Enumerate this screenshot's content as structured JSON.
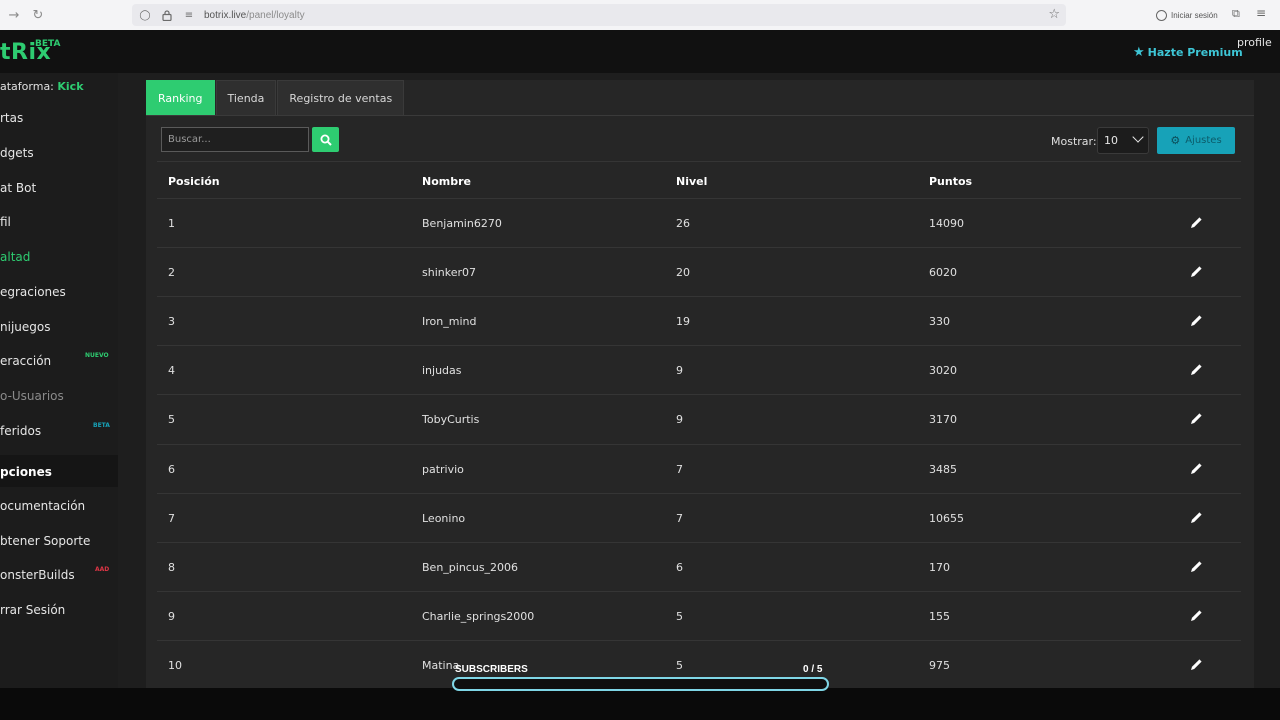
{
  "browser": {
    "url_host": "botrix.live",
    "url_path": "/panel/loyalty",
    "signin_label": "Iniciar sesión"
  },
  "header": {
    "logo": "tRix",
    "logo_badge": "BETA",
    "premium_label": "Hazte Premium",
    "profile_label": "profile"
  },
  "sidebar": {
    "platform_label": "ataforma:",
    "platform_value": "Kick",
    "items": [
      {
        "label": "rtas"
      },
      {
        "label": "dgets"
      },
      {
        "label": "at Bot"
      },
      {
        "label": "fil"
      },
      {
        "label": "altad"
      },
      {
        "label": "egraciones"
      },
      {
        "label": "nijuegos"
      },
      {
        "label": "eracción",
        "badge": "NUEVO"
      },
      {
        "label": "o-Usuarios"
      },
      {
        "label": "feridos",
        "badge": "BETA"
      }
    ],
    "section_label": "pciones",
    "section_items": [
      {
        "label": "ocumentación"
      },
      {
        "label": "btener Soporte"
      },
      {
        "label": "onsterBuilds",
        "badge": "AAD"
      },
      {
        "label": "rrar Sesión"
      }
    ],
    "colors": {
      "accent": "#2ecc71",
      "nuevo": "#2ecc71",
      "beta": "#17a2b8",
      "aad": "#dc3545"
    }
  },
  "tabs": [
    {
      "label": "Ranking",
      "active": true
    },
    {
      "label": "Tienda",
      "active": false
    },
    {
      "label": "Registro de ventas",
      "active": false
    }
  ],
  "toolbar": {
    "search_placeholder": "Buscar...",
    "search_icon": "search-icon",
    "show_label": "Mostrar:",
    "show_value": "10",
    "settings_label": "Ajustes",
    "settings_icon": "gears-icon"
  },
  "table": {
    "columns": [
      "Posición",
      "Nombre",
      "Nivel",
      "Puntos"
    ],
    "rows": [
      {
        "pos": "1",
        "name": "Benjamin6270",
        "level": "26",
        "points": "14090"
      },
      {
        "pos": "2",
        "name": "shinker07",
        "level": "20",
        "points": "6020"
      },
      {
        "pos": "3",
        "name": "Iron_mind",
        "level": "19",
        "points": "330"
      },
      {
        "pos": "4",
        "name": "injudas",
        "level": "9",
        "points": "3020"
      },
      {
        "pos": "5",
        "name": "TobyCurtis",
        "level": "9",
        "points": "3170"
      },
      {
        "pos": "6",
        "name": "patrivio",
        "level": "7",
        "points": "3485"
      },
      {
        "pos": "7",
        "name": "Leonino",
        "level": "7",
        "points": "10655"
      },
      {
        "pos": "8",
        "name": "Ben_pincus_2006",
        "level": "6",
        "points": "170"
      },
      {
        "pos": "9",
        "name": "Charlie_springs2000",
        "level": "5",
        "points": "155"
      },
      {
        "pos": "10",
        "name": "Matina",
        "level": "5",
        "points": "975"
      }
    ]
  },
  "overlay": {
    "label": "SUBSCRIBERS",
    "count": "0 / 5",
    "progress": 0
  },
  "colors": {
    "accent": "#2ecc71",
    "info": "#17a2b8",
    "premium": "#3ec6d6"
  }
}
